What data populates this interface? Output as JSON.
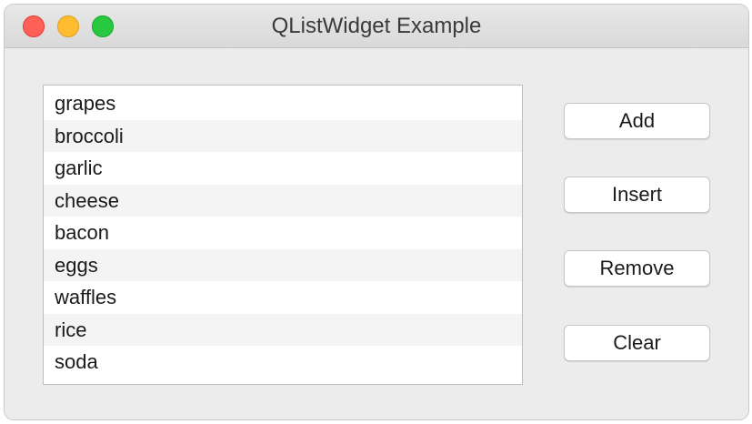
{
  "window": {
    "title": "QListWidget Example"
  },
  "list": {
    "items": [
      "grapes",
      "broccoli",
      "garlic",
      "cheese",
      "bacon",
      "eggs",
      "waffles",
      "rice",
      "soda"
    ]
  },
  "buttons": {
    "add": "Add",
    "insert": "Insert",
    "remove": "Remove",
    "clear": "Clear"
  }
}
